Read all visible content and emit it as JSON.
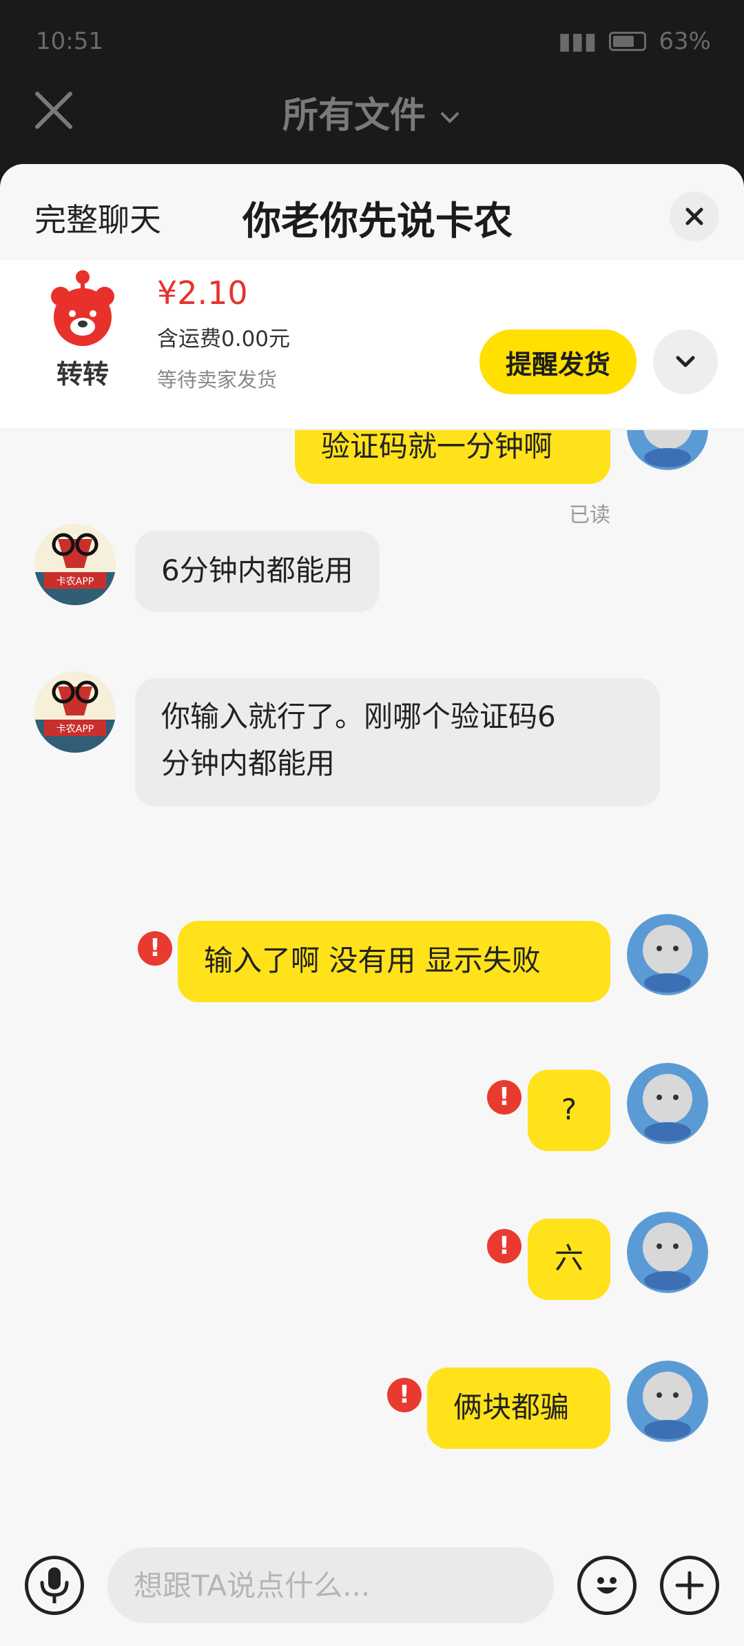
{
  "status_bar": {
    "time": "10:51",
    "battery": "63%"
  },
  "background_header": {
    "title": "所有文件"
  },
  "sheet": {
    "full_chat_label": "完整聊天",
    "chat_title": "你老你先说卡农"
  },
  "order": {
    "app_name": "转转",
    "price": "¥2.10",
    "shipping": "含运费0.00元",
    "status": "等待卖家发货",
    "remind_label": "提醒发货"
  },
  "messages": [
    {
      "from": "me",
      "text": "验证码就一分钟啊",
      "read_label": "已读"
    },
    {
      "from": "them",
      "text": "6分钟内都能用"
    },
    {
      "from": "them",
      "line1": "你输入就行了。刚哪个验证码6",
      "line2": "分钟内都能用"
    },
    {
      "from": "me",
      "text": "输入了啊 没有用 显示失败",
      "failed": true
    },
    {
      "from": "me",
      "text": "?",
      "failed": true
    },
    {
      "from": "me",
      "text": "六",
      "failed": true
    },
    {
      "from": "me",
      "text": "俩块都骗",
      "failed": true
    }
  ],
  "input": {
    "placeholder": "想跟TA说点什么..."
  },
  "colors": {
    "accent": "#ffe21a",
    "price": "#e8312b",
    "error": "#e93a2f"
  }
}
